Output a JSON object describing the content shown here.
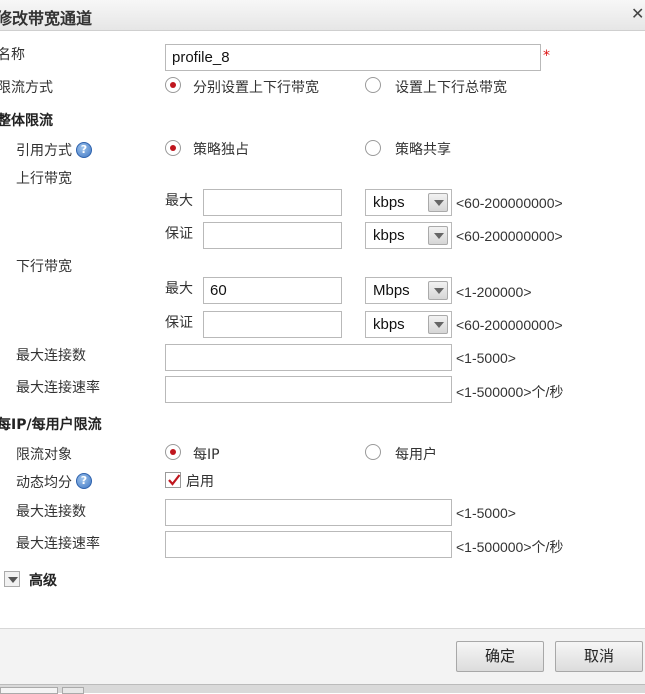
{
  "dialog": {
    "title": "修改带宽通道"
  },
  "name_field": {
    "label": "名称",
    "value": "profile_8",
    "required_mark": "*"
  },
  "limit_mode": {
    "label": "限流方式",
    "option_separate": "分别设置上下行带宽",
    "option_total": "设置上下行总带宽",
    "selected": "separate"
  },
  "overall": {
    "section_label": "整体限流",
    "reference_label": "引用方式",
    "option_exclusive": "策略独占",
    "option_shared": "策略共享",
    "selected": "exclusive",
    "upstream": {
      "label": "上行带宽",
      "max_label": "最大",
      "max_value": "",
      "max_unit": "kbps",
      "max_range": "<60-200000000>",
      "guarantee_label": "保证",
      "guarantee_value": "",
      "guarantee_unit": "kbps",
      "guarantee_range": "<60-200000000>"
    },
    "downstream": {
      "label": "下行带宽",
      "max_label": "最大",
      "max_value": "60",
      "max_unit": "Mbps",
      "max_range": "<1-200000>",
      "guarantee_label": "保证",
      "guarantee_value": "",
      "guarantee_unit": "kbps",
      "guarantee_range": "<60-200000000>"
    },
    "max_conn_label": "最大连接数",
    "max_conn_value": "",
    "max_conn_range": "<1-5000>",
    "max_conn_rate_label": "最大连接速率",
    "max_conn_rate_value": "",
    "max_conn_rate_range": "<1-500000>个/秒"
  },
  "per_ip": {
    "section_label": "每IP/每用户限流",
    "target_label": "限流对象",
    "option_ip": "每IP",
    "option_user": "每用户",
    "selected": "ip",
    "dynamic_label": "动态均分",
    "enable_label": "启用",
    "enable_checked": true,
    "max_conn_label": "最大连接数",
    "max_conn_value": "",
    "max_conn_range": "<1-5000>",
    "max_conn_rate_label": "最大连接速率",
    "max_conn_rate_value": "",
    "max_conn_rate_range": "<1-500000>个/秒"
  },
  "advanced": {
    "label": "高级"
  },
  "footer": {
    "ok_label": "确定",
    "cancel_label": "取消"
  },
  "colors": {
    "radio_dot": "#c0161e",
    "required": "#dd1111",
    "check": "#c0161e",
    "help_icon": "#3f77c4"
  }
}
